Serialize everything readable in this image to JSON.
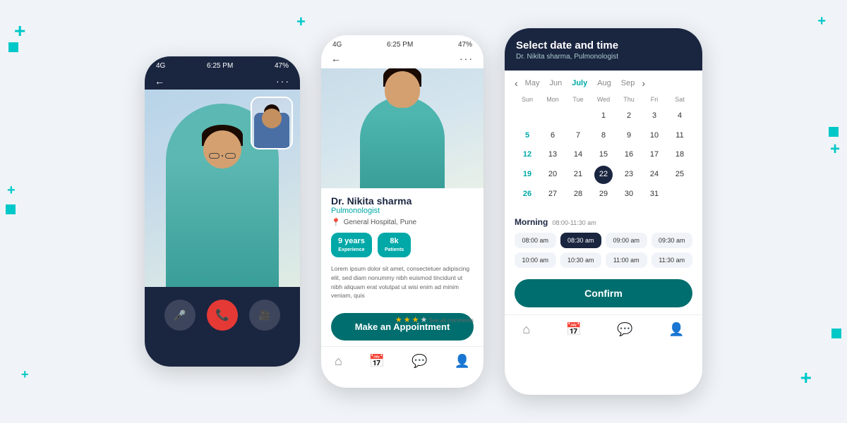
{
  "page": {
    "background": "#e8eef5"
  },
  "phone1": {
    "status_bar": {
      "signal": "4G",
      "time": "6:25 PM",
      "battery": "47%"
    },
    "controls": {
      "mute_label": "🎤",
      "end_label": "📞",
      "video_label": "📷"
    }
  },
  "phone2": {
    "status_bar": {
      "signal": "4G",
      "time": "6:25 PM",
      "battery": "47%"
    },
    "doctor": {
      "name": "Dr. Nikita sharma",
      "specialty": "Pulmonologist",
      "location": "General Hospital, Pune",
      "experience": "9 years",
      "experience_label": "Experience",
      "patients": "8k",
      "patients_label": "Patients",
      "description": "Lorem ipsum dolor sit amet, consectetuer adipiscing elit, sed diam nonummy nibh euismod tincidunt ut nibh aliquam erat volutpat ut wisi enim ad minim veniam, quis",
      "stars": 3.5,
      "see_all": "See all comments"
    },
    "appointment_btn": "Make an Appointment",
    "nav": {
      "home": "⌂",
      "calendar": "📅",
      "chat": "💬",
      "profile": "👤"
    }
  },
  "phone3": {
    "header": {
      "title": "Select date and time",
      "subtitle": "Dr. Nikita sharma, Pulmonologist"
    },
    "calendar": {
      "months": [
        "May",
        "Jun",
        "July",
        "Aug",
        "Sep"
      ],
      "active_month": "July",
      "days_of_week": [
        "Sun",
        "Mon",
        "Tue",
        "Wed",
        "Thu",
        "Fri",
        "Sat"
      ],
      "weeks": [
        [
          "",
          "",
          "",
          "1",
          "2",
          "3",
          "4"
        ],
        [
          "5",
          "6",
          "7",
          "8",
          "9",
          "10",
          "11"
        ],
        [
          "12",
          "13",
          "14",
          "15",
          "16",
          "17",
          "18"
        ],
        [
          "19",
          "20",
          "21",
          "22",
          "23",
          "24",
          "25"
        ],
        [
          "26",
          "27",
          "28",
          "29",
          "30",
          "31",
          ""
        ]
      ],
      "selected_day": "22",
      "highlight_days": [
        "5",
        "12",
        "19",
        "26"
      ]
    },
    "morning": {
      "label": "Morning",
      "time_range": "08:00-11:30 am",
      "slots": [
        "08:00 am",
        "08:30 am",
        "09:00 am",
        "09:30 am",
        "10:00 am",
        "10:30 am",
        "11:00 am",
        "11:30 am"
      ],
      "selected_slot": "08:30 am"
    },
    "confirm_btn": "Confirm",
    "nav": {
      "home": "⌂",
      "calendar": "📅",
      "chat": "💬",
      "profile": "👤"
    }
  }
}
